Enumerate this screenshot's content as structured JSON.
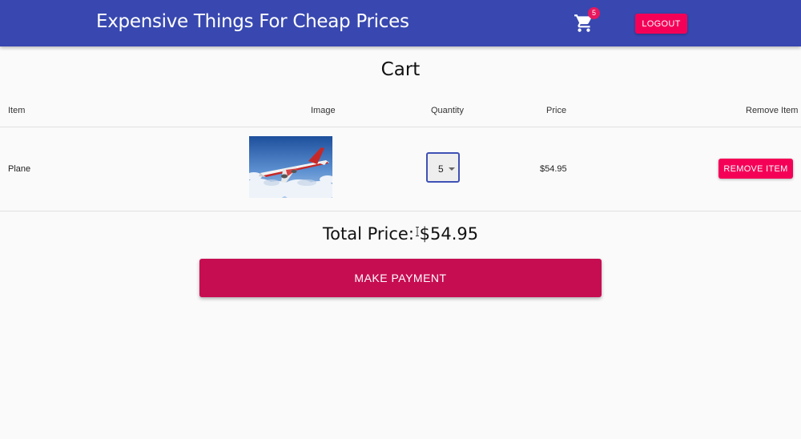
{
  "appbar": {
    "title": "Expensive Things For Cheap Prices",
    "cart_icon": "shopping-cart-icon",
    "cart_count": "5",
    "logout_label": "LOGOUT",
    "background_color": "#3848b0"
  },
  "page": {
    "title": "Cart"
  },
  "table": {
    "headers": [
      "Item",
      "Image",
      "Quantity",
      "Price",
      "Remove Item"
    ],
    "rows": [
      {
        "item": "Plane",
        "image": "airplane-photo",
        "quantity": "5",
        "price": "$54.95",
        "remove_label": "REMOVE ITEM"
      }
    ]
  },
  "summary": {
    "total_text": "Total Price: $54.95",
    "pay_label": "MAKE PAYMENT"
  },
  "colors": {
    "accent": "#f50057",
    "pay_button": "#c70d52",
    "focus": "#3f51b5"
  }
}
